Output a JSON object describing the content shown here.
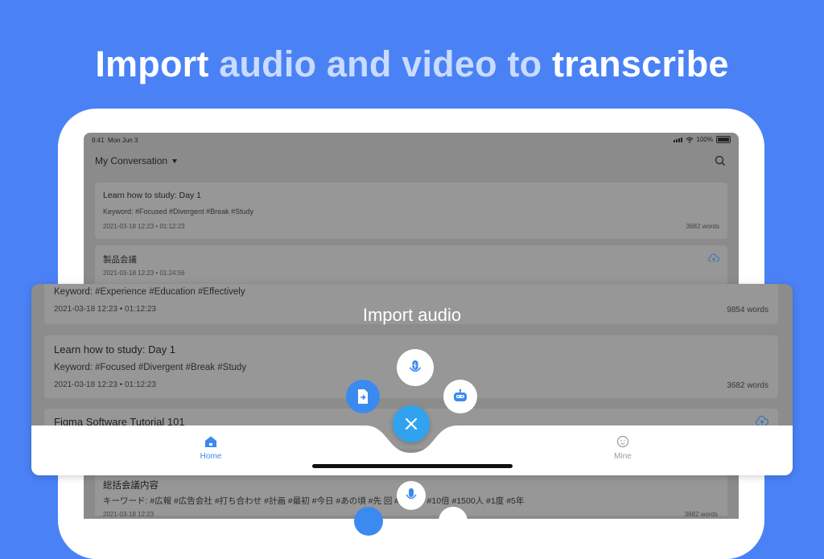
{
  "headline": {
    "part1": "Import ",
    "part2": "audio and  video to ",
    "part3": "transcribe"
  },
  "status_bar": {
    "time": "9:41",
    "date": "Mon Jun 3",
    "battery": "100%"
  },
  "header": {
    "title": "My Conversation",
    "search_icon": "search-icon"
  },
  "background_cards": [
    {
      "title": "Learn how to study: Day 1",
      "keywords": "Keyword:  #Focused  #Divergent  #Break  #Study",
      "date": "2021-03-18 12:23",
      "duration": "01:12:23",
      "words": "3682 words"
    },
    {
      "title": "製品会議",
      "date": "2021-03-18 12:23",
      "duration": "01:24:56",
      "icon": "cloud-upload-icon"
    }
  ],
  "panel_cards": [
    {
      "keywords": "Keyword:  #Experience  #Education  #Effectively",
      "date": "2021-03-18 12:23",
      "duration": "01:12:23",
      "words": "9854 words"
    },
    {
      "title": "Learn how to study: Day 1",
      "keywords": "Keyword:  #Focused  #Divergent  #Break  #Study",
      "date": "2021-03-18 12:23",
      "duration": "01:12:23",
      "words": "3682 words"
    },
    {
      "title": "Figma Software Tutorial 101",
      "icon": "cloud-upload-icon"
    }
  ],
  "import_label": "Import audio",
  "separator": "•",
  "fab_actions": [
    {
      "name": "record-audio",
      "icon": "mic-icon"
    },
    {
      "name": "import-file",
      "icon": "file-import-icon"
    },
    {
      "name": "ai-bot",
      "icon": "robot-icon"
    },
    {
      "name": "close",
      "icon": "close-icon"
    }
  ],
  "tabs": [
    {
      "label": "Home",
      "icon": "home-icon",
      "active": true
    },
    {
      "label": "Mine",
      "icon": "user-face-icon",
      "active": false
    }
  ],
  "lower_card": {
    "title": "総括会議内容",
    "keywords": "キーワード:  #広報  #広告会社  #打ち合わせ  #計画  #最初  #今日  #あの頃  #先  回  #コード  #10倍  #1500人  #1度  #5年",
    "date": "2021-03-18 12:23",
    "words": "3682 words"
  },
  "colors": {
    "background": "#4a82f6",
    "accent": "#3a8af0",
    "fab_close": "#31a3ee",
    "headline_highlight": "#c9dbff"
  }
}
